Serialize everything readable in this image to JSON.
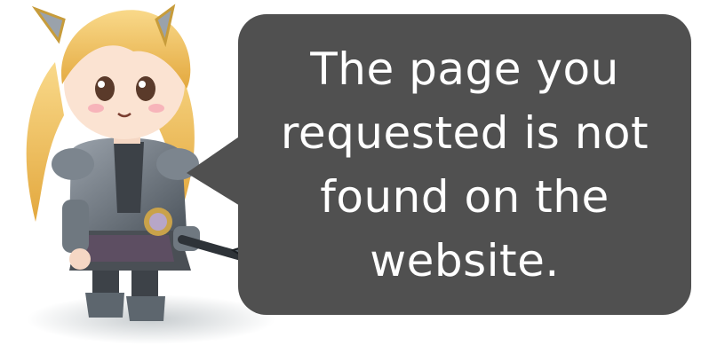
{
  "error": {
    "message": "The page you requested is not found on the website."
  },
  "colors": {
    "bubble": "#505050",
    "text": "#ffffff",
    "hair": "#f3c25a",
    "armor": "#6d7680",
    "mace": "#3b4148"
  },
  "icons": {
    "character": "chibi-warrior-girl-mascot",
    "weapon": "morning-star-mace-icon"
  }
}
